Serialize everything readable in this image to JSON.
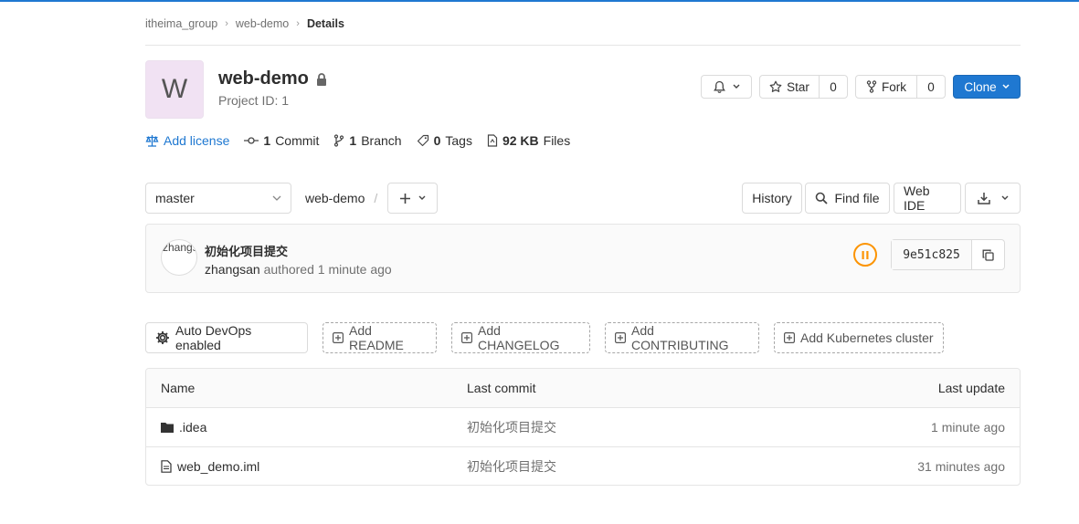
{
  "breadcrumb": {
    "group": "itheima_group",
    "project": "web-demo",
    "current": "Details"
  },
  "project": {
    "avatar_letter": "W",
    "name": "web-demo",
    "id_text": "Project ID: 1"
  },
  "actions": {
    "star_label": "Star",
    "star_count": "0",
    "fork_label": "Fork",
    "fork_count": "0",
    "clone_label": "Clone"
  },
  "stats": {
    "add_license": "Add license",
    "commits_count": "1",
    "commits_label": "Commit",
    "branches_count": "1",
    "branches_label": "Branch",
    "tags_count": "0",
    "tags_label": "Tags",
    "files_size": "92 KB",
    "files_label": "Files"
  },
  "tree": {
    "branch": "master",
    "path_root": "web-demo",
    "path_sep": "/",
    "history": "History",
    "find_file": "Find file",
    "web_ide": "Web IDE"
  },
  "commit": {
    "avatar_alt": "zhangsan",
    "title": "初始化项目提交",
    "author": "zhangsan",
    "authored_text": "authored 1 minute ago",
    "sha": "9e51c825",
    "pipeline_status_color": "#fc9403"
  },
  "quick_actions": {
    "auto_devops": "Auto DevOps enabled",
    "readme": "Add README",
    "changelog": "Add CHANGELOG",
    "contributing": "Add CONTRIBUTING",
    "kubernetes": "Add Kubernetes cluster"
  },
  "files_table": {
    "headers": [
      "Name",
      "Last commit",
      "Last update"
    ],
    "rows": [
      {
        "icon": "folder-icon",
        "name": ".idea",
        "last_commit": "初始化项目提交",
        "last_update": "1 minute ago"
      },
      {
        "icon": "file-icon",
        "name": "web_demo.iml",
        "last_commit": "初始化项目提交",
        "last_update": "31 minutes ago"
      }
    ]
  },
  "colors": {
    "accent": "#1f78d1",
    "pipeline_pending": "#fc9403"
  }
}
